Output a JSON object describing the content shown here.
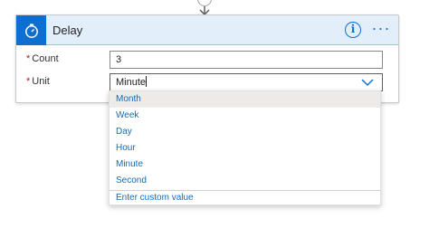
{
  "step": {
    "title": "Delay",
    "icon": "timer-icon",
    "accent_color": "#0f6fd1",
    "info_icon": "info-icon",
    "more_icon": "ellipsis-icon"
  },
  "fields": {
    "count": {
      "required_mark": "*",
      "label": "Count",
      "value": "3"
    },
    "unit": {
      "required_mark": "*",
      "label": "Unit",
      "value": "Minute"
    }
  },
  "dropdown": {
    "options": [
      "Month",
      "Week",
      "Day",
      "Hour",
      "Minute",
      "Second"
    ],
    "highlighted": "Month",
    "custom_label": "Enter custom value"
  }
}
